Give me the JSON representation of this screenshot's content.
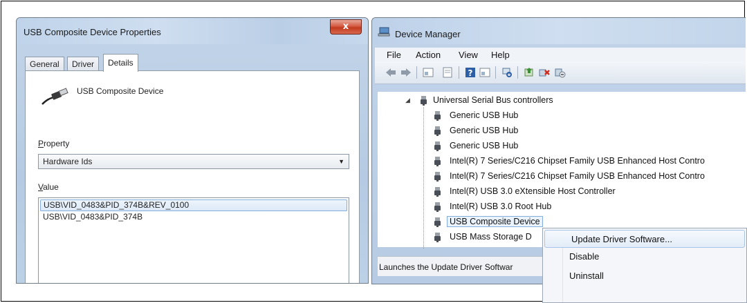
{
  "properties_dialog": {
    "title": "USB Composite Device Properties",
    "close_label": "x",
    "tabs": [
      {
        "label": "General",
        "active": false
      },
      {
        "label": "Driver",
        "active": false
      },
      {
        "label": "Details",
        "active": true
      }
    ],
    "device_name": "USB Composite Device",
    "property_label": "Property",
    "property_value": "Hardware Ids",
    "value_label": "Value",
    "values": [
      "USB\\VID_0483&PID_374B&REV_0100",
      "USB\\VID_0483&PID_374B"
    ]
  },
  "device_manager": {
    "title": "Device Manager",
    "menu": [
      "File",
      "Action",
      "View",
      "Help"
    ],
    "tree": {
      "category": "Universal Serial Bus controllers",
      "items": [
        "Generic USB Hub",
        "Generic USB Hub",
        "Generic USB Hub",
        "Intel(R) 7 Series/C216 Chipset Family USB Enhanced Host Contro",
        "Intel(R) 7 Series/C216 Chipset Family USB Enhanced Host Contro",
        "Intel(R) USB 3.0 eXtensible Host Controller",
        "Intel(R) USB 3.0 Root Hub",
        "USB Composite Device",
        "USB Mass Storage D"
      ]
    },
    "status_text": "Launches the Update Driver Softwar"
  },
  "context_menu": {
    "items": [
      "Update Driver Software...",
      "Disable",
      "Uninstall"
    ]
  },
  "colors": {
    "accent": "#84acdd",
    "close": "#c23a1f"
  }
}
